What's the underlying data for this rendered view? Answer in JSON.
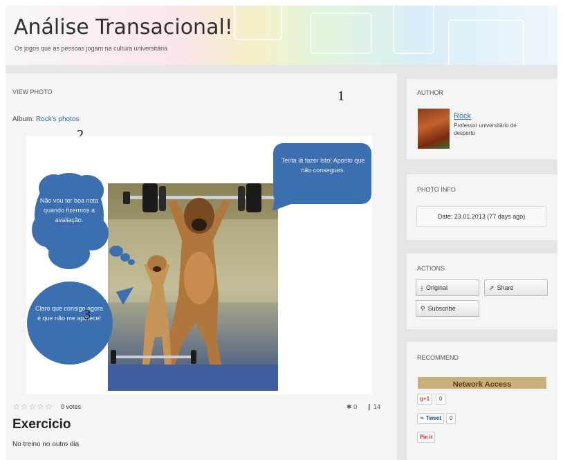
{
  "header": {
    "title": "Análise Transacional!",
    "subtitle": "Os jogos que as pessoas jogam na cultura universitária"
  },
  "main": {
    "section_title": "VIEW PHOTO",
    "album_label": "Album:",
    "album_link": "Rock's photos",
    "markers": [
      "1",
      "2",
      "3"
    ],
    "photo": {
      "bubble_top_right": "Tenta lá fazer isto! Aposto que não consegues.",
      "bubble_left_thought": "Não vou ter boa nota quando fizermos a avaliação.",
      "bubble_left_bottom": "Claro que consigo agora é que não me apetece!"
    },
    "rating": {
      "stars": "☆☆☆☆☆",
      "votes_label": "0 votes"
    },
    "stats": {
      "likes": "0",
      "comments": "14"
    },
    "photo_title": "Exercicio",
    "photo_description": "No treino no outro dia"
  },
  "sidebar": {
    "author": {
      "title": "AUTHOR",
      "name": "Rock",
      "description": "Professor universitário de desporto"
    },
    "photo_info": {
      "title": "PHOTO INFO",
      "date_label": "Date:",
      "date_value": "23.01.2013 (77 days ago)"
    },
    "actions": {
      "title": "ACTIONS",
      "original_label": "Original",
      "share_label": "Share",
      "subscribe_label": "Subscribe"
    },
    "recommend": {
      "title": "RECOMMEND",
      "banner_text": "Network Access",
      "gplus_label": "+1",
      "gplus_count": "0",
      "tweet_label": "Tweet",
      "tweet_count": "0",
      "pinit_label": "Pin it"
    }
  },
  "colors": {
    "link": "#2a6db5",
    "bubble": "#3b6fb0",
    "panel_bg": "#f5f5f5",
    "rail_bg": "#e5e5e5"
  }
}
